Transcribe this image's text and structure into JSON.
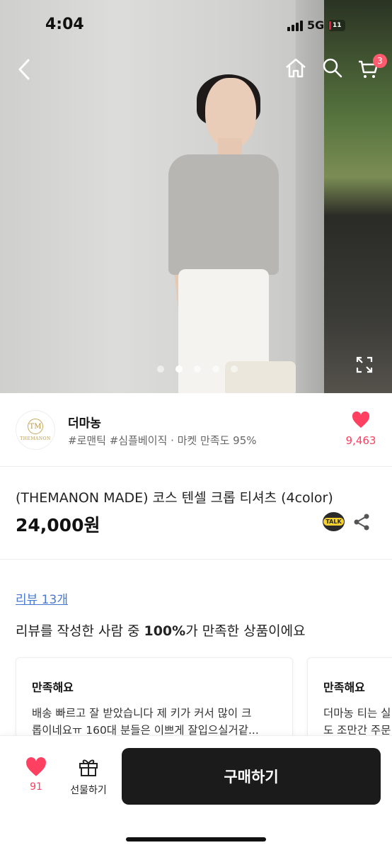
{
  "status_bar": {
    "time": "4:04",
    "network": "5G",
    "battery": "11"
  },
  "header": {
    "cart_count": "3"
  },
  "gallery": {
    "total_images": 5,
    "active_index": 1
  },
  "seller": {
    "name": "더마농",
    "tags": "#로맨틱 #심플베이직 · 마켓 만족도 95%",
    "like_count": "9,463",
    "logo_monogram": "TM",
    "logo_text": "THEMANON"
  },
  "product": {
    "title": "(THEMANON MADE) 코스 텐셀 크롭 티셔츠 (4color)",
    "price": "24,000원",
    "talk_label": "TALK"
  },
  "reviews": {
    "link_label": "리뷰 13개",
    "summary_prefix": "리뷰를 작성한 사람 중 ",
    "summary_percent": "100%",
    "summary_suffix": "가 만족한 상품이에요",
    "cards": [
      {
        "rating": "만족해요",
        "line1": "배송 빠르고 잘 받았습니다 제 키가 커서 많이 크",
        "line2": "롭이네요ㅠ 160대 분들은 이쁘게 잘입으실거같..."
      },
      {
        "rating": "만족해요",
        "line1": "더마농 티는 실",
        "line2": "도 조만간 주문"
      }
    ]
  },
  "bottom_bar": {
    "wish_count": "91",
    "gift_label": "선물하기",
    "buy_label": "구매하기"
  },
  "colors": {
    "accent_pink": "#ff4060",
    "link_blue": "#4a78d1",
    "buy_button_bg": "#1b1b1b",
    "badge": "#ff5a6e"
  }
}
